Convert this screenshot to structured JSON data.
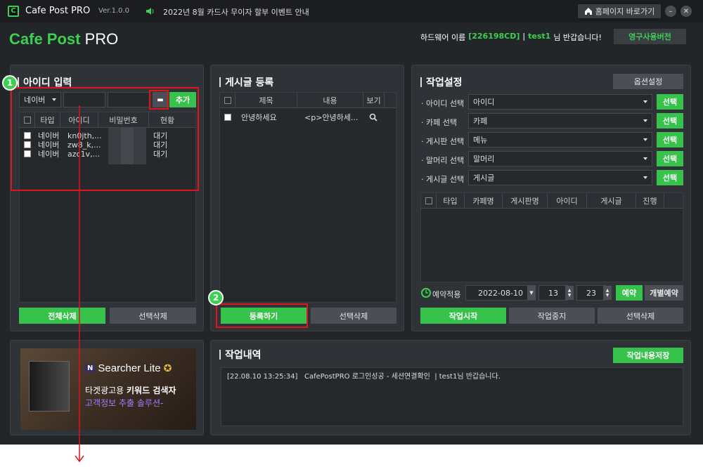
{
  "titlebar": {
    "app_name": "Cafe Post PRO",
    "version": "Ver.1.0.0",
    "notice": "2022년 8월 카드사 무이자 할부 이벤트 안내",
    "homepage_btn": "홈페이지 바로가기",
    "logo_letter": "C"
  },
  "header": {
    "logo_main": "Cafe Post",
    "logo_pro": "PRO",
    "hw_label": "하드웨어 이름",
    "hw_id": "[226198CD]",
    "sep": "|",
    "user": "test1",
    "greeting": "님 반갑습니다!",
    "license_btn": "영구사용버전"
  },
  "id_panel": {
    "title": "아이디 입력",
    "type_select": "네이버",
    "add_btn": "추가",
    "columns": [
      "타입",
      "아이디",
      "비밀번호",
      "현황"
    ],
    "rows": [
      {
        "type": "네이버",
        "id": "kn0jth,...",
        "status": "대기"
      },
      {
        "type": "네이버",
        "id": "zw8_k,...",
        "status": "대기"
      },
      {
        "type": "네이버",
        "id": "azc1v,...",
        "status": "대기"
      }
    ],
    "delete_all_btn": "전체삭제",
    "delete_sel_btn": "선택삭제"
  },
  "post_panel": {
    "title": "게시글 등록",
    "columns": [
      "제목",
      "내용",
      "보기"
    ],
    "rows": [
      {
        "title": "안녕하세요",
        "content": "<p>안녕하세..."
      }
    ],
    "register_btn": "등록하기",
    "delete_sel_btn": "선택삭제"
  },
  "task_panel": {
    "title": "작업설정",
    "options_btn": "옵션설정",
    "selects": [
      {
        "label": "· 아이디 선택",
        "value": "아이디",
        "btn": "선택"
      },
      {
        "label": "· 카페 선택",
        "value": "카페",
        "btn": "선택"
      },
      {
        "label": "· 게시판 선택",
        "value": "메뉴",
        "btn": "선택"
      },
      {
        "label": "· 말머리 선택",
        "value": "말머리",
        "btn": "선택"
      },
      {
        "label": "· 게시글 선택",
        "value": "게시글",
        "btn": "선택"
      }
    ],
    "columns": [
      "타입",
      "카페명",
      "게시판명",
      "아이디",
      "게시글",
      "진행"
    ],
    "reserve_label": "예약적용",
    "date": "2022-08-10",
    "hour": "13",
    "minute": "23",
    "reserve_btn": "예약",
    "individual_btn": "개별예약",
    "start_btn": "작업시작",
    "stop_btn": "작업중지",
    "delete_sel_btn": "선택삭제"
  },
  "ad": {
    "brand_n": "N",
    "brand_name": "Searcher Lite",
    "line1_a": "타겟광고용 ",
    "line1_b": "키워드 검색자",
    "line2": "고객정보 추출 솔루션-"
  },
  "log_panel": {
    "title": "작업내역",
    "save_btn": "작업내용저장",
    "log": "[22.08.10 13:25:34]   CafePostPRO 로그인성공 - 세션연결확인  | test1님 반갑습니다."
  },
  "markers": [
    "1",
    "2"
  ],
  "colors": {
    "accent": "#36c24b",
    "bg": "#232629",
    "panel": "#2f3337",
    "annotation": "#e0131e"
  }
}
